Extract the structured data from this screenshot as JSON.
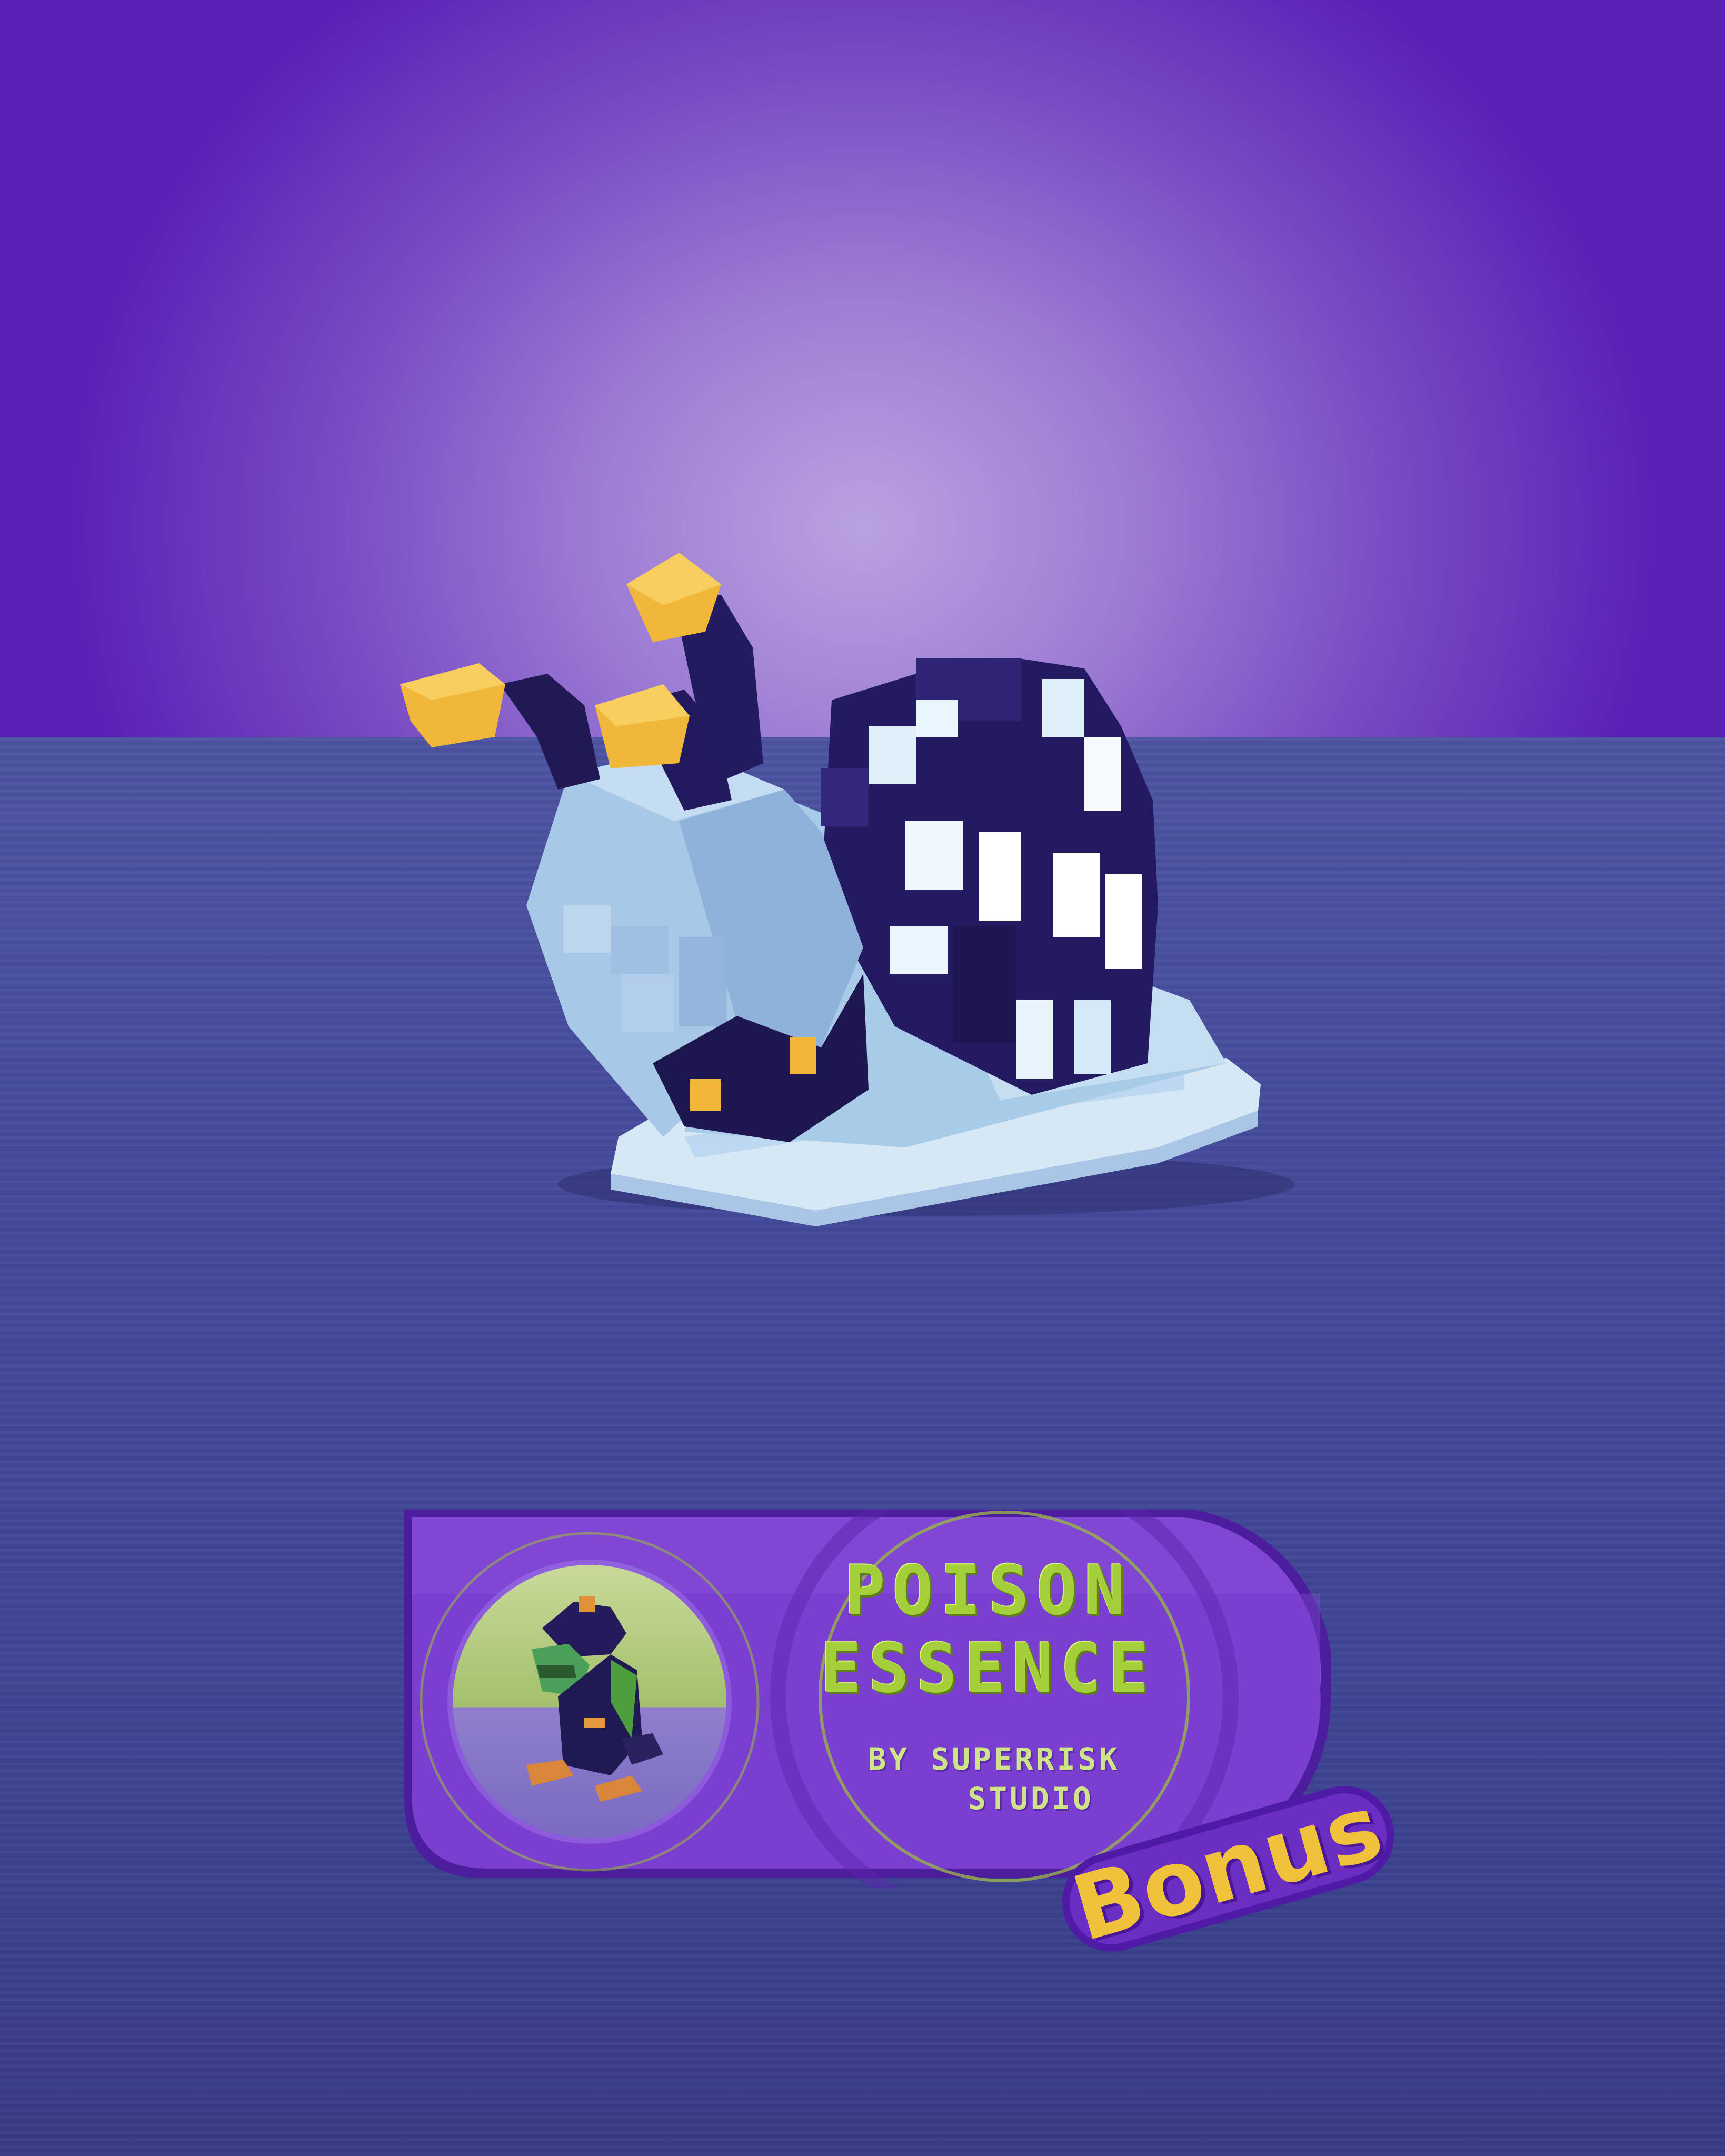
{
  "scene": {
    "subject": "voxel-snail",
    "colors": {
      "sky_top": "#5a21b6",
      "sky_glow": "#b9a2e0",
      "sea": "#454b9c",
      "snail_body": "#b7d3ee",
      "snail_dark": "#221a5e",
      "eye_gold": "#f3b63a"
    }
  },
  "banner": {
    "title_line1": "POISON",
    "title_line2": "ESSENCE",
    "byline_line1": "BY SUPERRISK",
    "byline_line2": "STUDIO",
    "badge": "Bonus",
    "colors": {
      "panel": "#7a3fd0",
      "title": "#a4cf3a",
      "badge_text": "#f0c23c"
    },
    "portrait_subject": "voxel-frog-icon"
  }
}
